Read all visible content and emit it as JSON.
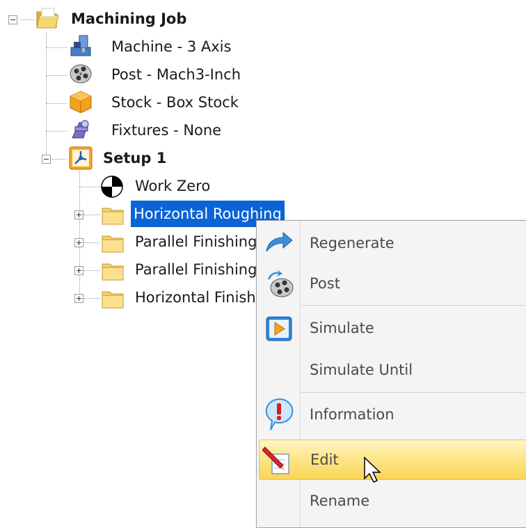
{
  "tree": {
    "root_label": "Machining Job",
    "children": [
      {
        "label": "Machine - 3 Axis",
        "icon": "machine-icon"
      },
      {
        "label": "Post - Mach3-Inch",
        "icon": "film-reel-icon"
      },
      {
        "label": "Stock - Box Stock",
        "icon": "stock-box-icon"
      },
      {
        "label": "Fixtures - None",
        "icon": "fixtures-icon"
      }
    ],
    "setup": {
      "label": "Setup 1",
      "work_zero": "Work Zero",
      "operations": [
        {
          "label": "Horizontal Roughing",
          "selected": true
        },
        {
          "label": "Parallel Finishing"
        },
        {
          "label": "Parallel Finishing"
        },
        {
          "label": "Horizontal Finish"
        }
      ]
    }
  },
  "context_menu": {
    "items": [
      {
        "label": "Regenerate",
        "icon": "regenerate-arrow-icon"
      },
      {
        "label": "Post",
        "icon": "post-reel-icon"
      },
      {
        "label": "Simulate",
        "icon": "play-icon"
      },
      {
        "label": "Simulate Until",
        "icon": ""
      },
      {
        "label": "Information",
        "icon": "info-exclamation-icon"
      },
      {
        "label": "Edit",
        "icon": "edit-pencil-icon",
        "highlighted": true
      },
      {
        "label": "Rename",
        "icon": ""
      }
    ]
  },
  "colors": {
    "selection": "#0a64d6",
    "menu_highlight": "#fde68a"
  }
}
